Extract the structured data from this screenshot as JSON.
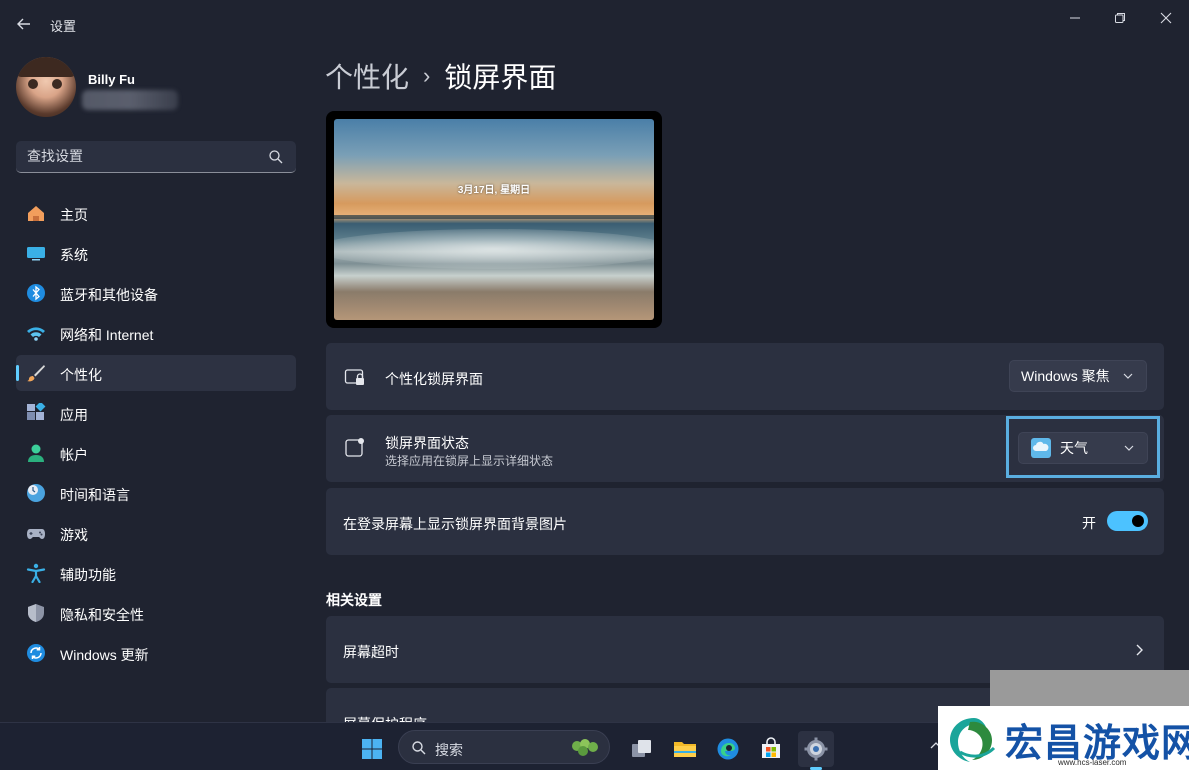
{
  "window": {
    "title": "设置",
    "back_icon": "back-arrow-icon",
    "minimize_icon": "minimize-icon",
    "maximize_icon": "restore-icon",
    "close_icon": "close-icon"
  },
  "user": {
    "name": "Billy Fu"
  },
  "search": {
    "placeholder": "查找设置",
    "icon": "search-icon"
  },
  "sidebar": {
    "items": [
      {
        "label": "主页",
        "icon": "home-icon",
        "active": false
      },
      {
        "label": "系统",
        "icon": "system-icon",
        "active": false
      },
      {
        "label": "蓝牙和其他设备",
        "icon": "bluetooth-icon",
        "active": false
      },
      {
        "label": "网络和 Internet",
        "icon": "wifi-icon",
        "active": false
      },
      {
        "label": "个性化",
        "icon": "brush-icon",
        "active": true
      },
      {
        "label": "应用",
        "icon": "apps-icon",
        "active": false
      },
      {
        "label": "帐户",
        "icon": "account-icon",
        "active": false
      },
      {
        "label": "时间和语言",
        "icon": "clock-globe-icon",
        "active": false
      },
      {
        "label": "游戏",
        "icon": "gamepad-icon",
        "active": false
      },
      {
        "label": "辅助功能",
        "icon": "accessibility-icon",
        "active": false
      },
      {
        "label": "隐私和安全性",
        "icon": "shield-icon",
        "active": false
      },
      {
        "label": "Windows 更新",
        "icon": "update-icon",
        "active": false
      }
    ]
  },
  "breadcrumb": {
    "parent": "个性化",
    "separator": "›",
    "current": "锁屏界面"
  },
  "preview": {
    "date_text": "3月17日, 星期日"
  },
  "settings": {
    "personalize_lock": {
      "title": "个性化锁屏界面",
      "value": "Windows 聚焦",
      "icon": "lock-screen-icon"
    },
    "lock_status": {
      "title": "锁屏界面状态",
      "subtitle": "选择应用在锁屏上显示详细状态",
      "value": "天气",
      "icon": "status-icon",
      "value_icon": "weather-icon"
    },
    "show_background": {
      "title": "在登录屏幕上显示锁屏界面背景图片",
      "toggle_label": "开",
      "toggle_on": true
    }
  },
  "related": {
    "heading": "相关设置",
    "items": [
      {
        "label": "屏幕超时"
      },
      {
        "label": "屏幕保护程序"
      }
    ]
  },
  "taskbar": {
    "search_label": "搜索",
    "apps": [
      "start-icon",
      "task-view-icon",
      "file-explorer-icon",
      "edge-icon",
      "store-icon",
      "settings-icon"
    ]
  },
  "watermark": {
    "text": "宏昌游戏网",
    "url": "www.hcs-laser.com"
  },
  "colors": {
    "accent": "#60cdff",
    "toggle": "#4cc2ff",
    "highlight": "#5aaee0",
    "background": "#1f2330",
    "card": "#2b3040"
  }
}
